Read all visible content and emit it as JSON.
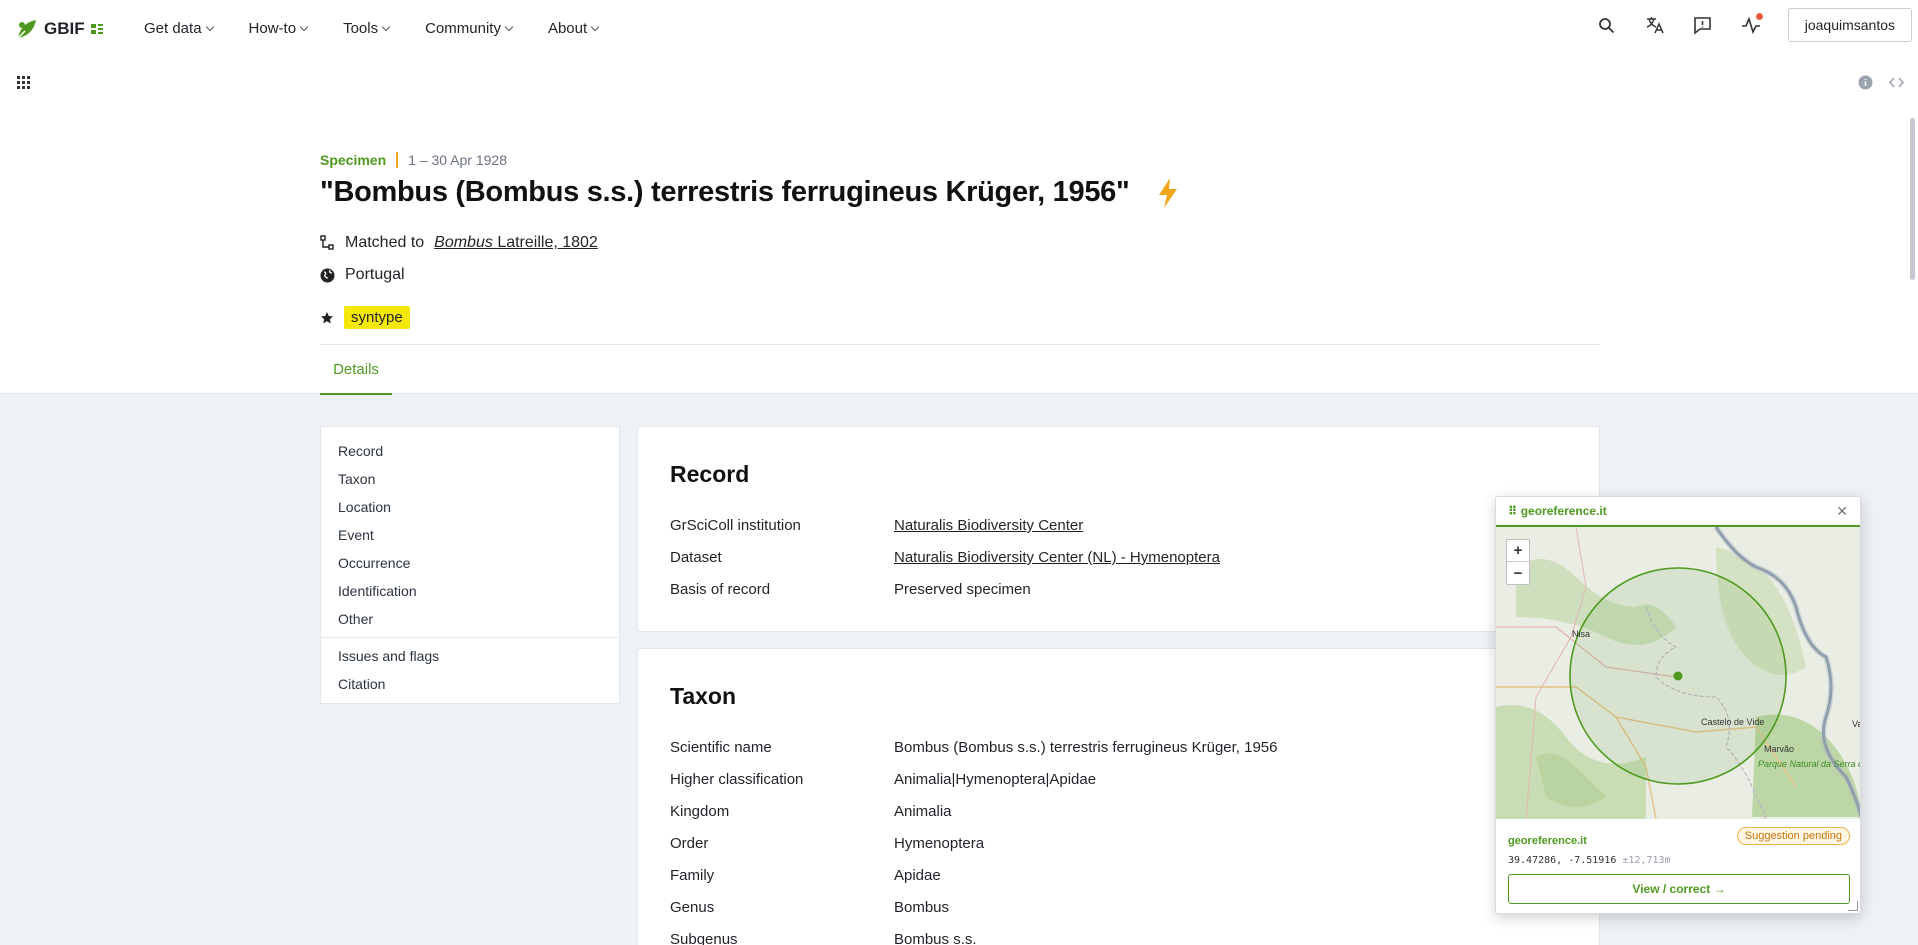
{
  "nav": {
    "logo_text": "GBIF",
    "menu": [
      {
        "label": "Get data"
      },
      {
        "label": "How-to"
      },
      {
        "label": "Tools"
      },
      {
        "label": "Community"
      },
      {
        "label": "About"
      }
    ],
    "user": "joaquimsantos",
    "icons": [
      "search-icon",
      "translate-icon",
      "feedback-icon",
      "activity-icon"
    ]
  },
  "header": {
    "type": "Specimen",
    "date": "1 – 30 Apr 1928",
    "title": "\"Bombus (Bombus s.s.) terrestris ferrugineus Krüger, 1956\"",
    "matched_label": "Matched to",
    "matched_genus": "Bombus",
    "matched_author": "Latreille, 1802",
    "country": "Portugal",
    "type_status": "syntype",
    "tab": "Details"
  },
  "toc": {
    "primary": [
      "Record",
      "Taxon",
      "Location",
      "Event",
      "Occurrence",
      "Identification",
      "Other"
    ],
    "secondary": [
      "Issues and flags",
      "Citation"
    ]
  },
  "record": {
    "heading": "Record",
    "rows": [
      {
        "k": "GrSciColl institution",
        "v": "Naturalis Biodiversity Center"
      },
      {
        "k": "Dataset",
        "v": "Naturalis Biodiversity Center (NL) - Hymenoptera"
      },
      {
        "k": "Basis of record",
        "v": "Preserved specimen"
      }
    ]
  },
  "taxon": {
    "heading": "Taxon",
    "rows": [
      {
        "k": "Scientific name",
        "v": "Bombus (Bombus s.s.) terrestris ferrugineus Krüger, 1956"
      },
      {
        "k": "Higher classification",
        "v": "Animalia|Hymenoptera|Apidae"
      },
      {
        "k": "Kingdom",
        "v": "Animalia"
      },
      {
        "k": "Order",
        "v": "Hymenoptera"
      },
      {
        "k": "Family",
        "v": "Apidae"
      },
      {
        "k": "Genus",
        "v": "Bombus"
      },
      {
        "k": "Subgenus",
        "v": "Bombus s.s."
      }
    ]
  },
  "geo": {
    "title": "georeference.it",
    "zoom_in": "+",
    "zoom_out": "−",
    "places": [
      "Nisa",
      "Castelo de Vide",
      "Marvão",
      "Parque Natural da Serra de São Mamede",
      "Va"
    ],
    "source": "georeference.it",
    "status": "Suggestion pending",
    "coords": "39.47286, -7.51916",
    "uncertainty": "±12,713m",
    "button": "View / correct →"
  },
  "colors": {
    "brand": "#4e9a1f",
    "accent": "#f2a619",
    "highlight": "#f4e80a"
  }
}
